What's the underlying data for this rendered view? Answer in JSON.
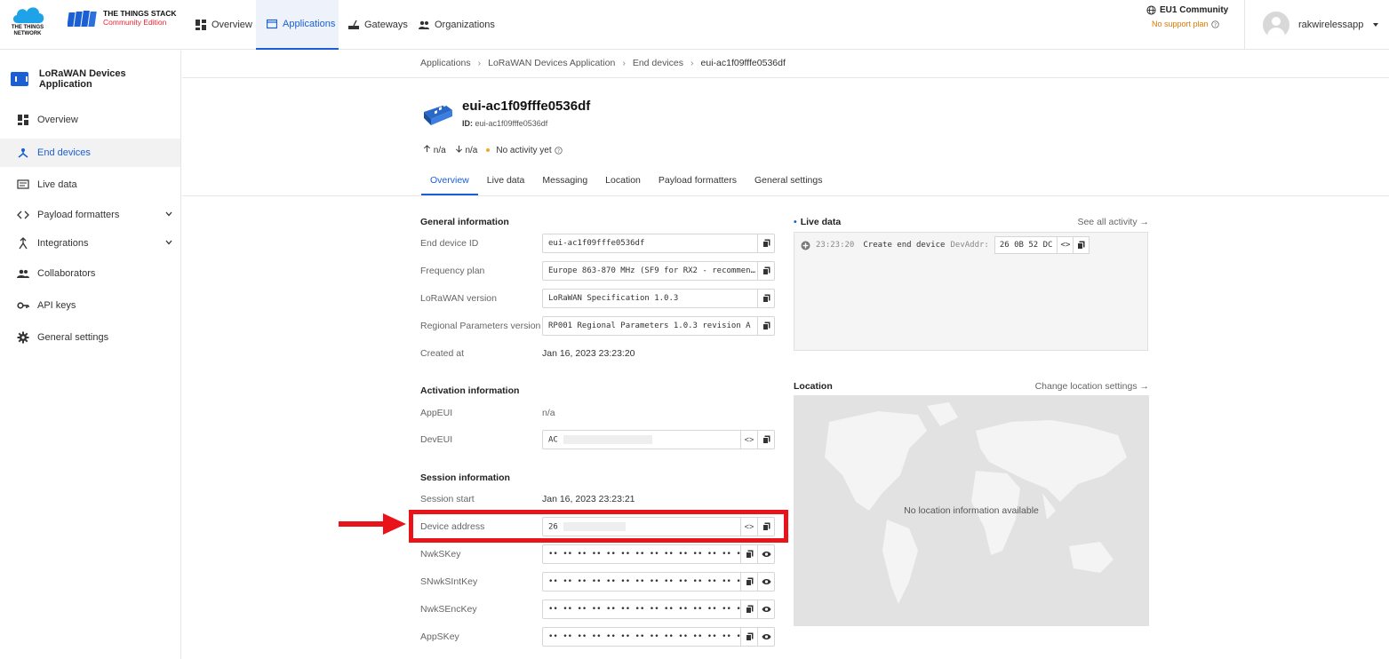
{
  "brand": {
    "ttn_text": "THE THINGS NETWORK",
    "stack_title": "THE THINGS STACK",
    "stack_edition": "Community Edition"
  },
  "topnav": [
    {
      "label": "Overview",
      "icon": "dashboard-icon"
    },
    {
      "label": "Applications",
      "icon": "application-icon",
      "active": true
    },
    {
      "label": "Gateways",
      "icon": "gateway-icon"
    },
    {
      "label": "Organizations",
      "icon": "organization-icon"
    }
  ],
  "cluster": {
    "name": "EU1 Community",
    "plan": "No support plan"
  },
  "user": {
    "name": "rakwirelessapp"
  },
  "sidebar": {
    "app_name": "LoRaWAN Devices Application",
    "items": [
      {
        "label": "Overview"
      },
      {
        "label": "End devices",
        "active": true
      },
      {
        "label": "Live data"
      },
      {
        "label": "Payload formatters"
      },
      {
        "label": "Integrations"
      },
      {
        "label": "Collaborators"
      },
      {
        "label": "API keys"
      },
      {
        "label": "General settings"
      }
    ]
  },
  "breadcrumb": [
    "Applications",
    "LoRaWAN Devices Application",
    "End devices",
    "eui-ac1f09fffe0536df"
  ],
  "device": {
    "title": "eui-ac1f09fffe0536df",
    "id_label": "ID:",
    "id_value": "eui-ac1f09fffe0536df",
    "uplink": "n/a",
    "downlink": "n/a",
    "activity": "No activity yet"
  },
  "tabs": [
    "Overview",
    "Live data",
    "Messaging",
    "Location",
    "Payload formatters",
    "General settings"
  ],
  "general": {
    "title": "General information",
    "end_device_id_label": "End device ID",
    "end_device_id": "eui-ac1f09fffe0536df",
    "frequency_plan_label": "Frequency plan",
    "frequency_plan": "Europe 863-870 MHz (SF9 for RX2 - recommen…",
    "lorawan_version_label": "LoRaWAN version",
    "lorawan_version": "LoRaWAN Specification 1.0.3",
    "regional_label": "Regional Parameters version",
    "regional": "RP001 Regional Parameters 1.0.3 revision A",
    "created_label": "Created at",
    "created": "Jan 16, 2023 23:23:20"
  },
  "activation": {
    "title": "Activation information",
    "appeui_label": "AppEUI",
    "appeui": "n/a",
    "deveui_label": "DevEUI",
    "deveui": "AC"
  },
  "session": {
    "title": "Session information",
    "start_label": "Session start",
    "start": "Jan 16, 2023 23:23:21",
    "devaddr_label": "Device address",
    "devaddr": "26",
    "nwkskey_label": "NwkSKey",
    "snwksintkey_label": "SNwkSIntKey",
    "nwksenckey_label": "NwkSEncKey",
    "appskey_label": "AppSKey",
    "masked": "•• •• •• •• •• •• •• •• •• •• •• •• •• •• •• ••"
  },
  "live": {
    "title": "Live data",
    "link": "See all activity →",
    "time": "23:23:20",
    "event": "Create end device",
    "addr_label": "DevAddr:",
    "addr": "26 0B 52 DC"
  },
  "location": {
    "title": "Location",
    "link": "Change location settings →",
    "empty": "No location information available"
  },
  "colors": {
    "accent": "#1a5fd3",
    "highlight": "#e8141a",
    "warning": "#e07a00"
  }
}
